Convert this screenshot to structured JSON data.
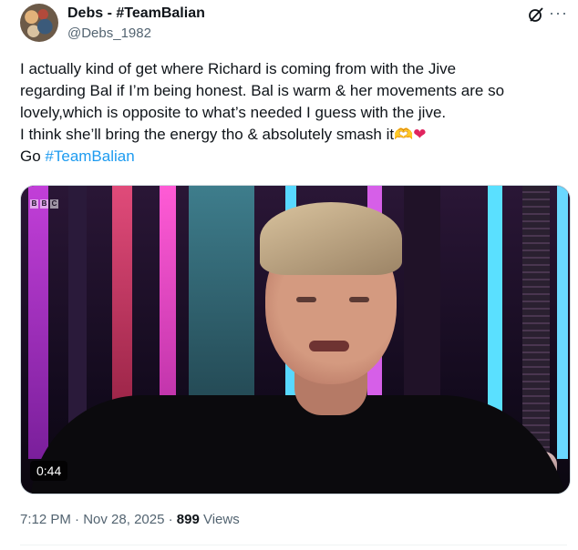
{
  "author": {
    "display_name": "Debs - #TeamBalian",
    "handle": "@Debs_1982"
  },
  "tweet": {
    "lines": [
      "I actually kind of get where Richard is coming from with the Jive",
      "regarding Bal if I’m being honest. Bal is warm & her movements are so",
      "lovely,which is opposite to what’s needed I guess with the jive.",
      "I think she’ll bring the energy tho & absolutely smash it"
    ],
    "emoji_gold_heart": "🫶",
    "emoji_red_heart": "❤",
    "last_line_prefix": "Go ",
    "hashtag": "#TeamBalian"
  },
  "video": {
    "channel_logo": [
      "B",
      "B",
      "C"
    ],
    "duration": "0:44"
  },
  "meta": {
    "time": "7:12 PM",
    "separator": " · ",
    "date": "Nov 28, 2025",
    "views_count": "899",
    "views_label": " Views"
  },
  "icons": {
    "more": "···",
    "grok": "grok-icon"
  },
  "colors": {
    "hashtag": "#1d9bf0",
    "secondary_text": "#536471",
    "primary_text": "#0f1419"
  }
}
